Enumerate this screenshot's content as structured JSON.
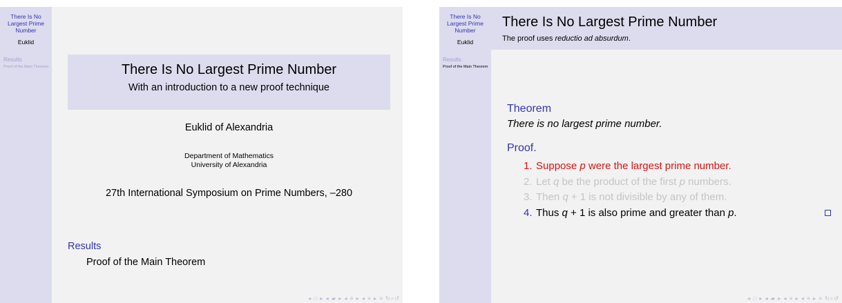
{
  "sidebar": {
    "title": "There Is No Largest Prime Number",
    "author": "Euklid",
    "section": "Results",
    "subsection": "Proof of the Main Theorem"
  },
  "title_slide": {
    "title": "There Is No Largest Prime Number",
    "subtitle": "With an introduction to a new proof technique",
    "author": "Euklid of Alexandria",
    "institute_line1": "Department of Mathematics",
    "institute_line2": "University of Alexandria",
    "date": "27th International Symposium on Prime Numbers, –280",
    "toc_section": "Results",
    "toc_subsection": "Proof of the Main Theorem"
  },
  "frame_slide": {
    "title": "There Is No Largest Prime Number",
    "subtitle_prefix": "The proof uses ",
    "subtitle_em": "reductio ad absurdum",
    "subtitle_suffix": ".",
    "theorem_label": "Theorem",
    "theorem_text": "There is no largest prime number.",
    "proof_label": "Proof.",
    "steps": [
      {
        "num": "1.",
        "a": "Suppose ",
        "v1": "p",
        "b": " were the largest prime number.",
        "v2": "",
        "c": ""
      },
      {
        "num": "2.",
        "a": "Let ",
        "v1": "q",
        "b": " be the product of the first ",
        "v2": "p",
        "c": " numbers."
      },
      {
        "num": "3.",
        "a": "Then ",
        "v1": "q",
        "b": " + 1 is not divisible by any of them.",
        "v2": "",
        "c": ""
      },
      {
        "num": "4.",
        "a": "Thus ",
        "v1": "q",
        "b": " + 1 is also prime and greater than ",
        "v2": "p",
        "c": "."
      }
    ]
  },
  "navigation_symbols": "◂ □ ▸ ◂ ▰ ▸ ◂ ≡ ▸ ◂ ≡ ▸  ≡  ↻⌕↺",
  "colors": {
    "structure": "#3333b3",
    "alert": "#e01010",
    "background": "#f2f2f2",
    "sidebar": "#dcdcee"
  }
}
